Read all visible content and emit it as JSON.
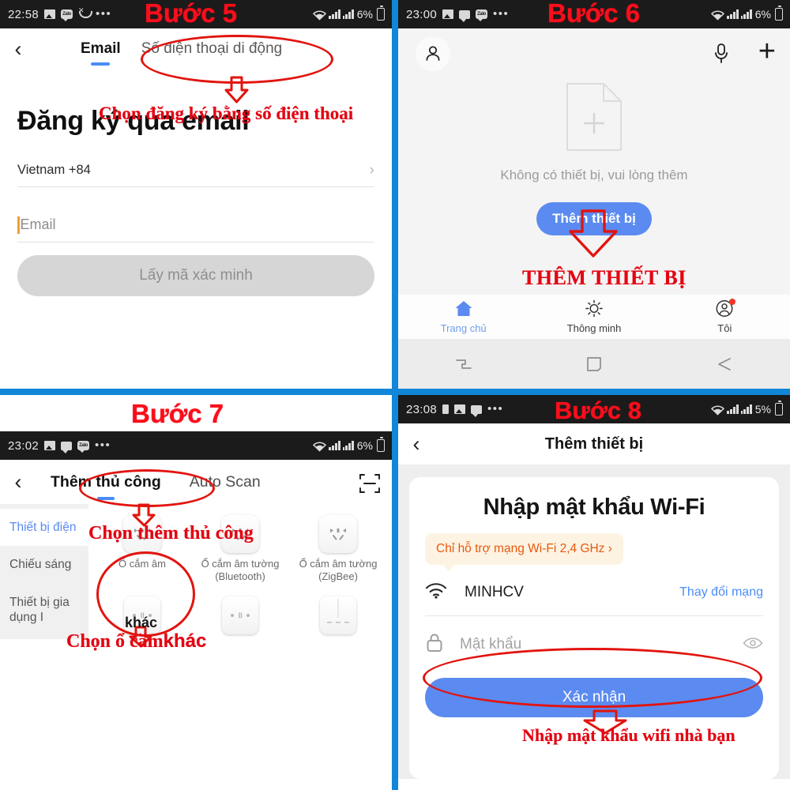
{
  "tutorial": {
    "step5_title": "Bước 5",
    "step6_title": "Bước 6",
    "step7_title": "Bước 7",
    "step8_title": "Bước 8",
    "note5": "Chọn đăng ký bằng số điện thoại",
    "note6": "THÊM THIẾT BỊ",
    "note7a": "Chọn thêm thủ công",
    "note7b": "Chọn ổ căm",
    "note7b_bold": "khác",
    "note7_icon_overlay": "khác",
    "note8": "Nhập mật khẩu wifi nhà bạn",
    "accent_red": "#e2140f",
    "accent_blue": "#1286d8"
  },
  "panel5": {
    "statusbar": {
      "time": "22:58",
      "icons": [
        "photo-icon",
        "zalo-icon",
        "missed-call-icon",
        "overflow-dots-icon"
      ],
      "wifi": "wifi-icon",
      "signal1": "signal-bars-icon",
      "signal2": "signal-bars-icon",
      "battery_pct": "6%",
      "battery": "battery-icon"
    },
    "back": "‹",
    "tab_email": "Email",
    "tab_phone": "Số điện thoại di động",
    "heading": "Đăng ký qua email",
    "country_row": "Vietnam +84",
    "country_chevron": "›",
    "email_placeholder": "Email",
    "submit_label": "Lấy mã xác minh"
  },
  "panel6": {
    "statusbar": {
      "time": "23:00",
      "battery_pct": "6%"
    },
    "avatar": "person-icon",
    "mic": "microphone-icon",
    "plus": "+",
    "empty_text": "Không có thiết bị, vui lòng thêm",
    "add_device_label": "Thêm thiết bị",
    "tabs": [
      {
        "label": "Trang chủ",
        "icon": "home-icon",
        "active": true,
        "badge": false
      },
      {
        "label": "Thông minh",
        "icon": "sun-icon",
        "active": false,
        "badge": false
      },
      {
        "label": "Tôi",
        "icon": "account-circle-icon",
        "active": false,
        "badge": true
      }
    ],
    "navbar": [
      "recents-icon",
      "home-square-icon",
      "back-arrow-icon"
    ]
  },
  "panel7": {
    "statusbar": {
      "time": "23:02",
      "battery_pct": "6%"
    },
    "back": "‹",
    "tab_manual": "Thêm thủ công",
    "tab_autoscan": "Auto Scan",
    "scan_icon": "qr-scan-icon",
    "categories": [
      {
        "label": "Thiết bị điện",
        "active": true
      },
      {
        "label": "Chiếu sáng",
        "active": false
      },
      {
        "label": "Thiết bị gia dụng I",
        "active": false
      }
    ],
    "devices": [
      {
        "label": "Ổ cắm âm",
        "icon": "socket-icon"
      },
      {
        "label": "Ổ cắm âm tường (Bluetooth)",
        "icon": "socket-icon"
      },
      {
        "label": "Ổ cắm âm tường (ZigBee)",
        "icon": "socket-icon"
      },
      {
        "label": "",
        "icon": "switch-icon"
      },
      {
        "label": "",
        "icon": "switch-icon"
      },
      {
        "label": "",
        "icon": "switch-panel-icon"
      }
    ]
  },
  "panel8": {
    "statusbar": {
      "time": "23:08",
      "battery_pct": "5%"
    },
    "back": "‹",
    "title": "Thêm thiết bị",
    "heading": "Nhập mật khẩu Wi-Fi",
    "tip": "Chỉ hỗ trợ mạng Wi-Fi 2,4 GHz ›",
    "ssid": "MINHCV",
    "change_network": "Thay đổi mạng",
    "password_placeholder": "Mật khẩu",
    "eye_icon": "eye-icon",
    "lock_icon": "lock-icon",
    "wifi_icon": "wifi-icon",
    "confirm_label": "Xác nhận"
  }
}
